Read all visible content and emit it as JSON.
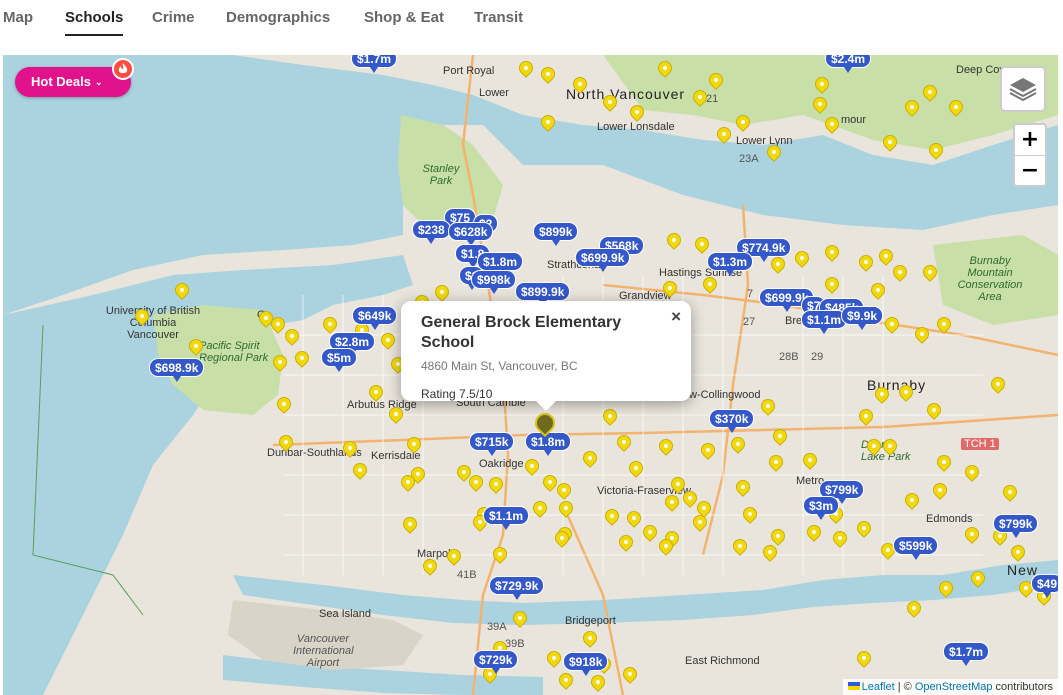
{
  "tabs": [
    {
      "label": "Map",
      "active": false
    },
    {
      "label": "Schools",
      "active": true
    },
    {
      "label": "Crime",
      "active": false
    },
    {
      "label": "Demographics",
      "active": false
    },
    {
      "label": "Shop & Eat",
      "active": false
    },
    {
      "label": "Transit",
      "active": false
    }
  ],
  "hot_deals": {
    "label": "Hot Deals",
    "chevron": "⌄",
    "flame_icon": "flame-icon"
  },
  "controls": {
    "zoom_in": "+",
    "zoom_out": "−",
    "layers_icon": "layers-icon"
  },
  "popup": {
    "title": "General Brock Elementary School",
    "address": "4860 Main St, Vancouver, BC",
    "rating": "Rating 7.5/10",
    "close": "×"
  },
  "selected_price": "$1.8m",
  "prices": [
    "$1.7m",
    "$2.4m",
    "$75",
    "$2",
    "$238",
    "$628k",
    "$899k",
    "$568k",
    "$1.8",
    "$1.8m",
    "$699.9k",
    "$774.9k",
    "$1",
    "$998k",
    "$1.3m",
    "$899.9k",
    "$649k",
    "$699.9k",
    "$7",
    "$485k",
    "$1.1m",
    "$9.9k",
    "$2.8m",
    "$5m",
    "$698.9k",
    "$715k",
    "$1.8m",
    "$370k",
    "$799k",
    "$3m",
    "$1.1m",
    "$599k",
    "$799k",
    "$729.9k",
    "$49",
    "$729k",
    "$918k",
    "$1.7m"
  ],
  "map_labels": {
    "north_vancouver": "North Vancouver",
    "port_royal": "Port Royal",
    "lower_lonsdale": "Lower Lonsdale",
    "lower_lynn": "Lower Lynn",
    "lower_hamilton": "Lower",
    "deep_cove": "Deep Cove",
    "seymour": "mour",
    "stanley_park": "Stanley Park",
    "university": "University of British Columbia Vancouver",
    "pacific_spirit": "Pacific Spirit Regional Park",
    "arbutus": "Arbutus Ridge",
    "dunbar": "Dunbar-Southlands",
    "kerrisdale": "Kerrisdale",
    "south_cambie": "South Cambie",
    "oakridge": "Oakridge",
    "marpole": "Marpole",
    "sea_island": "Sea Island",
    "airport": "Vancouver International Airport",
    "bridgeport": "Bridgeport",
    "east_richmond": "East Richmond",
    "victoria": "Victoria-Fraserview",
    "renfrew": "w-Collingwood",
    "grandview": "Grandview",
    "hastings": "Hastings Sunrise",
    "strathcona": "Strathcona",
    "burnaby": "Burnaby",
    "burnaby_mountain": "Burnaby Mountain Conservation Area",
    "deer_lake": "Deer Lake Park",
    "metrotown": "Metro",
    "edmonds": "Edmonds",
    "new_west": "New",
    "brentwood": "Bre",
    "tch": "TCH 1",
    "gr": "Gr",
    "road_23a": "23A",
    "road_21": "21",
    "road_7": "7",
    "road_27": "27",
    "road_28b": "28B",
    "road_29": "29",
    "road_41b": "41B",
    "road_39a": "39A",
    "road_39b": "39B"
  },
  "attribution": {
    "leaflet": "Leaflet",
    "sep": " | © ",
    "osm": "OpenStreetMap",
    "tail": " contributors"
  },
  "colors": {
    "water": "#aad3df",
    "land": "#e9e5dc",
    "park": "#c8dfa8",
    "price_pin": "#3558c9",
    "school_pin": "#f2d90f",
    "hot_deals": "#e0128c"
  }
}
